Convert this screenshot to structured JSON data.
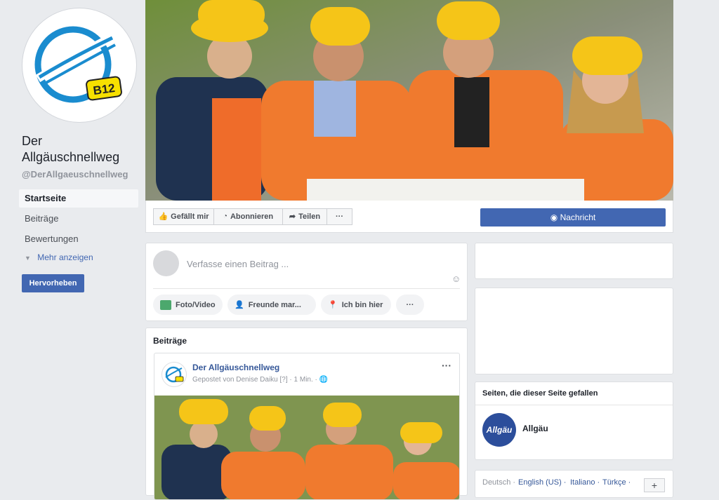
{
  "page": {
    "name": "Der Allgäuschnellweg",
    "handle": "@DerAllgaeuschnellweg",
    "logo_badge": "B12"
  },
  "nav": {
    "items": [
      "Startseite",
      "Beiträge",
      "Bewertungen"
    ],
    "more": "Mehr anzeigen",
    "highlight": "Hervorheben"
  },
  "actions": {
    "like": "Gefällt mir",
    "follow": "Abonnieren",
    "share": "Teilen",
    "more": "···",
    "message": "Nachricht"
  },
  "composer": {
    "placeholder": "Verfasse einen Beitrag ...",
    "photo": "Foto/Video",
    "tag": "Freunde mar...",
    "checkin": "Ich bin hier",
    "more": "···"
  },
  "posts": {
    "title": "Beiträge",
    "post": {
      "author": "Der Allgäuschnellweg",
      "meta": "Gepostet von Denise Daiku",
      "meta_q": "[?]",
      "time": "· 1 Min. ·",
      "options": "···"
    }
  },
  "liked_pages": {
    "title": "Seiten, die dieser Seite gefallen",
    "item": "Allgäu",
    "logo_text": "Allgäu"
  },
  "languages": {
    "items": [
      "Deutsch ·",
      "English (US) ·",
      "Italiano ·",
      "Türkçe ·"
    ],
    "add": "+"
  },
  "colors": {
    "brand": "#4267b2",
    "link": "#365899",
    "background": "#e9ebee"
  }
}
